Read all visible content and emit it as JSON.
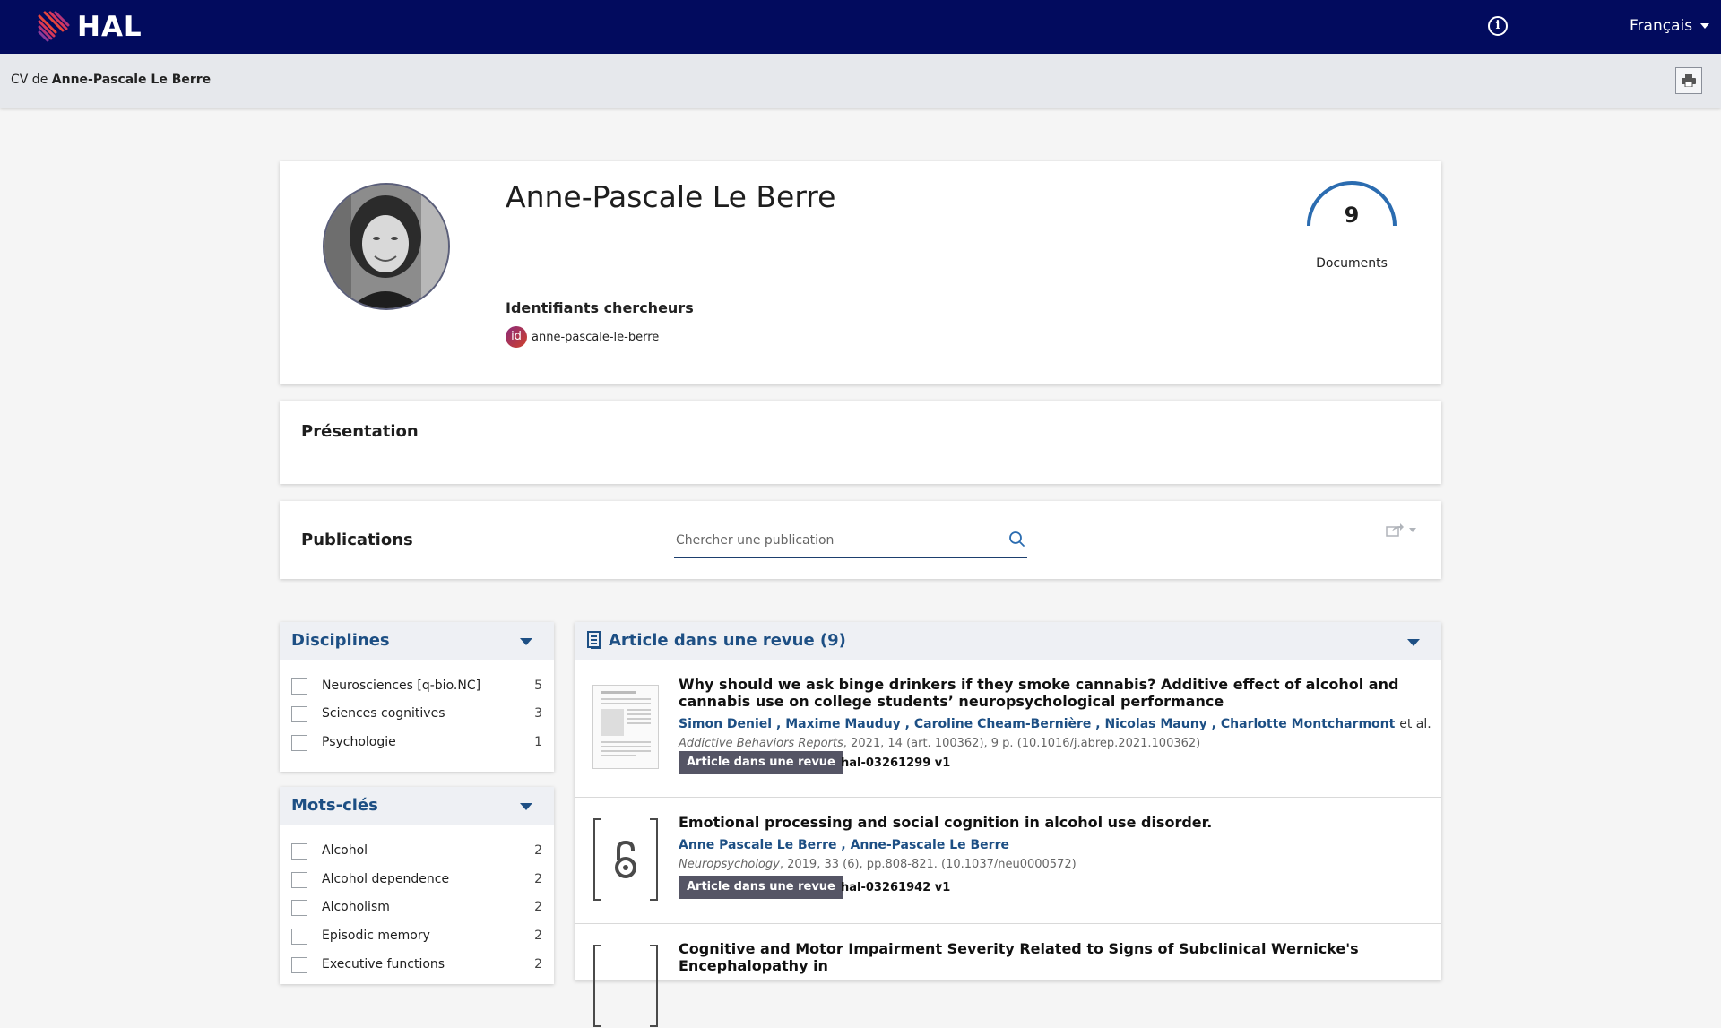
{
  "header": {
    "logo_text": "HAL",
    "language": "Français",
    "brand_color": "#020b5e"
  },
  "breadcrumb": {
    "prefix": "CV de",
    "name": "Anne-Pascale Le Berre"
  },
  "profile": {
    "name": "Anne-Pascale Le Berre",
    "identifiers_title": "Identifiants chercheurs",
    "idref_badge": "id",
    "identifier": "anne-pascale-le-berre",
    "document_count": "9",
    "document_label": "Documents"
  },
  "presentation": {
    "title": "Présentation"
  },
  "publications": {
    "title": "Publications",
    "search_placeholder": "Chercher une publication"
  },
  "facets": {
    "disciplines": {
      "title": "Disciplines",
      "items": [
        {
          "label": "Neurosciences [q-bio.NC]",
          "count": "5"
        },
        {
          "label": "Sciences cognitives",
          "count": "3"
        },
        {
          "label": "Psychologie",
          "count": "1"
        }
      ]
    },
    "keywords": {
      "title": "Mots-clés",
      "items": [
        {
          "label": "Alcohol",
          "count": "2"
        },
        {
          "label": "Alcohol dependence",
          "count": "2"
        },
        {
          "label": "Alcoholism",
          "count": "2"
        },
        {
          "label": "Episodic memory",
          "count": "2"
        },
        {
          "label": "Executive functions",
          "count": "2"
        }
      ]
    }
  },
  "results": {
    "title": "Article dans une revue (9)",
    "items": [
      {
        "title": "Why should we ask binge drinkers if they smoke cannabis? Additive effect of alcohol and cannabis use on college students’ neuropsychological performance",
        "authors": [
          "Simon Deniel",
          "Maxime Mauduy",
          "Caroline Cheam-Bernière",
          "Nicolas Mauny",
          "Charlotte Montcharmont"
        ],
        "etal": "et al.",
        "journal": "Addictive Behaviors Reports",
        "details": ", 2021, 14 (art. 100362), 9 p. (10.1016/j.abrep.2021.100362)",
        "type": "Article dans une revue",
        "hal_id": "hal-03261299 v1"
      },
      {
        "title": "Emotional processing and social cognition in alcohol use disorder.",
        "authors": [
          "Anne Pascale Le Berre",
          "Anne-Pascale Le Berre"
        ],
        "etal": "",
        "journal": "Neuropsychology",
        "details": ", 2019, 33 (6), pp.808-821. (10.1037/neu0000572)",
        "type": "Article dans une revue",
        "hal_id": "hal-03261942 v1"
      },
      {
        "title": "Cognitive and Motor Impairment Severity Related to Signs of Subclinical Wernicke's Encephalopathy in"
      }
    ]
  }
}
